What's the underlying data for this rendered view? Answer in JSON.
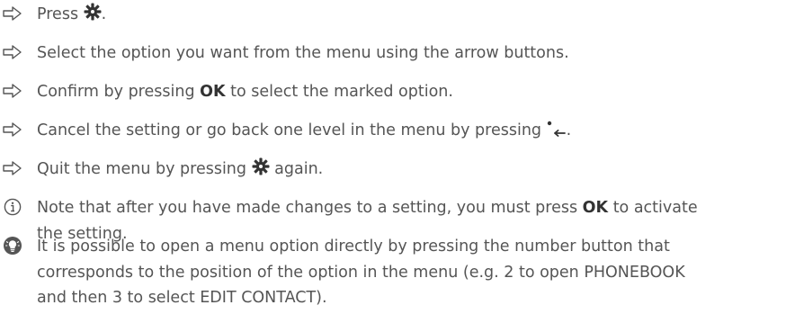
{
  "steps": [
    {
      "icon": "arrow-right-icon",
      "before": "Press",
      "after": "."
    },
    {
      "icon": "arrow-right-icon",
      "text": "Select the option you want from the menu using the arrow buttons."
    },
    {
      "icon": "arrow-right-icon",
      "before": "Confirm by pressing",
      "key": "OK",
      "after": "to select the marked option."
    },
    {
      "icon": "arrow-right-icon",
      "before": "Cancel the setting or go back one level in the menu by pressing",
      "after": "."
    },
    {
      "icon": "arrow-right-icon",
      "before": "Quit the menu by pressing",
      "after": "again."
    }
  ],
  "note": {
    "icon": "info-icon",
    "before": "Note that after you have made changes to a setting, you must press",
    "key": "OK",
    "after": "to activate",
    "line2": "the setting."
  },
  "tip": {
    "icon": "tip-icon",
    "line1": "It is possible to open a menu option directly by pressing the number button that",
    "line2": "corresponds to the position of the option in the menu (e.g. 2 to open PHONEBOOK",
    "line3": "and then 3 to select EDIT CONTACT)."
  },
  "colors": {
    "text": "#555555",
    "icon": "#555555",
    "bold": "#333333"
  }
}
